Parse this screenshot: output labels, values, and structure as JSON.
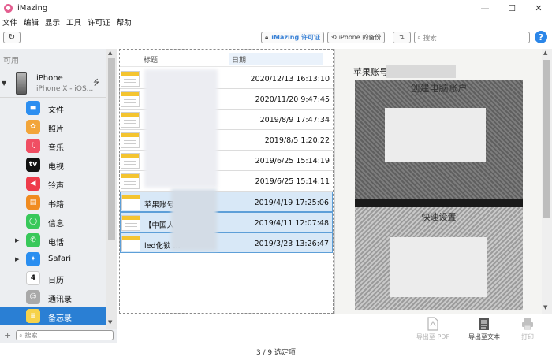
{
  "window": {
    "title": "iMazing",
    "controls": {
      "minimize": "—",
      "maximize": "☐",
      "close": "✕"
    }
  },
  "menu": [
    "文件",
    "编辑",
    "显示",
    "工具",
    "许可证",
    "帮助"
  ],
  "toolbar": {
    "license_label": "iMazing 许可证",
    "backup_label": "iPhone 的备份",
    "sort_label": "⇅",
    "search_placeholder": "搜索",
    "help_label": "?"
  },
  "sidebar": {
    "header": "可用",
    "device": {
      "name": "iPhone",
      "model": "iPhone X - iOS..."
    },
    "items": [
      {
        "label": "文件",
        "icon": "folder-icon",
        "color": "#2c8ef0",
        "glyph": "▬",
        "expander": false,
        "selected": false
      },
      {
        "label": "照片",
        "icon": "photos-icon",
        "color": "#f2a53a",
        "glyph": "✿",
        "expander": false,
        "selected": false
      },
      {
        "label": "音乐",
        "icon": "music-icon",
        "color": "#f04e63",
        "glyph": "♫",
        "expander": false,
        "selected": false
      },
      {
        "label": "电视",
        "icon": "tv-icon",
        "color": "#111111",
        "glyph": "tv",
        "expander": false,
        "selected": false
      },
      {
        "label": "铃声",
        "icon": "ringtone-icon",
        "color": "#ee3b4a",
        "glyph": "◀",
        "expander": false,
        "selected": false
      },
      {
        "label": "书籍",
        "icon": "books-icon",
        "color": "#f08b20",
        "glyph": "▤",
        "expander": false,
        "selected": false
      },
      {
        "label": "信息",
        "icon": "messages-icon",
        "color": "#38c85a",
        "glyph": "◯",
        "expander": false,
        "selected": false
      },
      {
        "label": "电话",
        "icon": "phone-icon",
        "color": "#38c85a",
        "glyph": "✆",
        "expander": true,
        "selected": false
      },
      {
        "label": "Safari",
        "icon": "safari-icon",
        "color": "#2a8ef0",
        "glyph": "✦",
        "expander": true,
        "selected": false
      },
      {
        "label": "日历",
        "icon": "calendar-icon",
        "color": "#ffffff",
        "glyph": "4",
        "expander": false,
        "selected": false
      },
      {
        "label": "通讯录",
        "icon": "contacts-icon",
        "color": "#a9a9a9",
        "glyph": "☺",
        "expander": false,
        "selected": false
      },
      {
        "label": "备忘录",
        "icon": "notes-icon",
        "color": "#f6d24a",
        "glyph": "≡",
        "expander": false,
        "selected": true
      }
    ],
    "search_placeholder": "搜索"
  },
  "list": {
    "columns": {
      "title": "标题",
      "date": "日期"
    },
    "rows": [
      {
        "title": "",
        "date": "2020/12/13 16:13:10",
        "selected": false
      },
      {
        "title": "",
        "date": "2020/11/20 9:47:45",
        "selected": false
      },
      {
        "title": "",
        "date": "2019/8/9 17:47:34",
        "selected": false
      },
      {
        "title": "",
        "date": "2019/8/5 1:20:22",
        "selected": false
      },
      {
        "title": "",
        "date": "2019/6/25 15:14:19",
        "selected": false
      },
      {
        "title": "",
        "date": "2019/6/25 15:14:11",
        "selected": false
      },
      {
        "title": "苹果账号",
        "date": "2019/4/19 17:25:06",
        "selected": true
      },
      {
        "title": "【中国人",
        "date": "2019/4/11 12:07:48",
        "selected": true
      },
      {
        "title": "led化锁 ...",
        "date": "2019/3/23 13:26:47",
        "selected": true
      }
    ]
  },
  "preview": {
    "title": "苹果账号",
    "photo_caption_1": "创建电脑账户",
    "photo_caption_2": "快速设置"
  },
  "actions": {
    "export_pdf": "导出至 PDF",
    "export_text": "导出至文本",
    "print": "打印"
  },
  "status": "3 / 9 选定项"
}
